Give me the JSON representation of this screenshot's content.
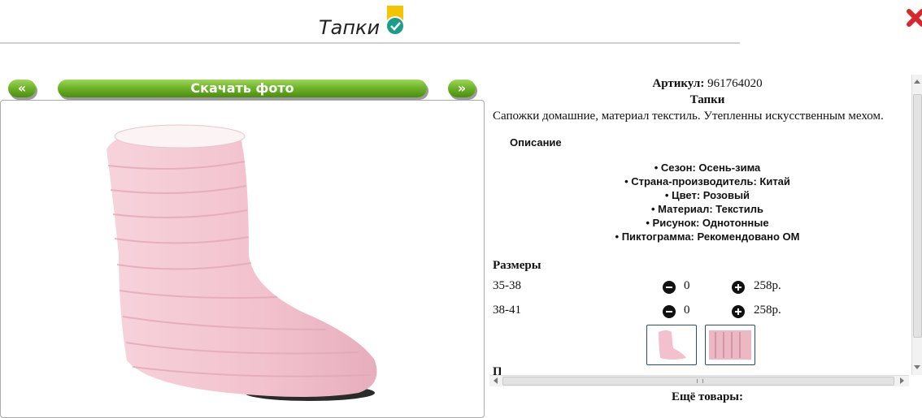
{
  "header": {
    "title": "Тапки"
  },
  "buttons": {
    "prev": "«",
    "download": "Скачать фото",
    "next": "»"
  },
  "product": {
    "sku_label": "Артикул:",
    "sku": "961764020",
    "name": "Тапки",
    "description": "Сапожки домашние, материал текстиль. Утепленны искусственным мехом."
  },
  "description_section": {
    "heading": "Описание",
    "properties": [
      "• Сезон: Осень-зима",
      "• Страна-производитель: Китай",
      "• Цвет: Розовый",
      "• Материал: Текстиль",
      "• Рисунок: Однотонные",
      "• Пиктограмма: Рекомендовано ОМ"
    ]
  },
  "sizes": {
    "heading": "Размеры",
    "rows": [
      {
        "label": "35-38",
        "qty": "0",
        "price": "258р."
      },
      {
        "label": "38-41",
        "qty": "0",
        "price": "258р."
      }
    ]
  },
  "more": {
    "heading": "Ещё товары:"
  },
  "colors": {
    "button_green": "#6fb52a",
    "close_red": "#d9262b",
    "badge_yellow": "#f5c400",
    "badge_teal": "#1a9e8a",
    "product_pink": "#f2c4cf"
  },
  "icons": [
    "verified-badge-icon",
    "close-icon",
    "minus-icon",
    "plus-icon"
  ]
}
